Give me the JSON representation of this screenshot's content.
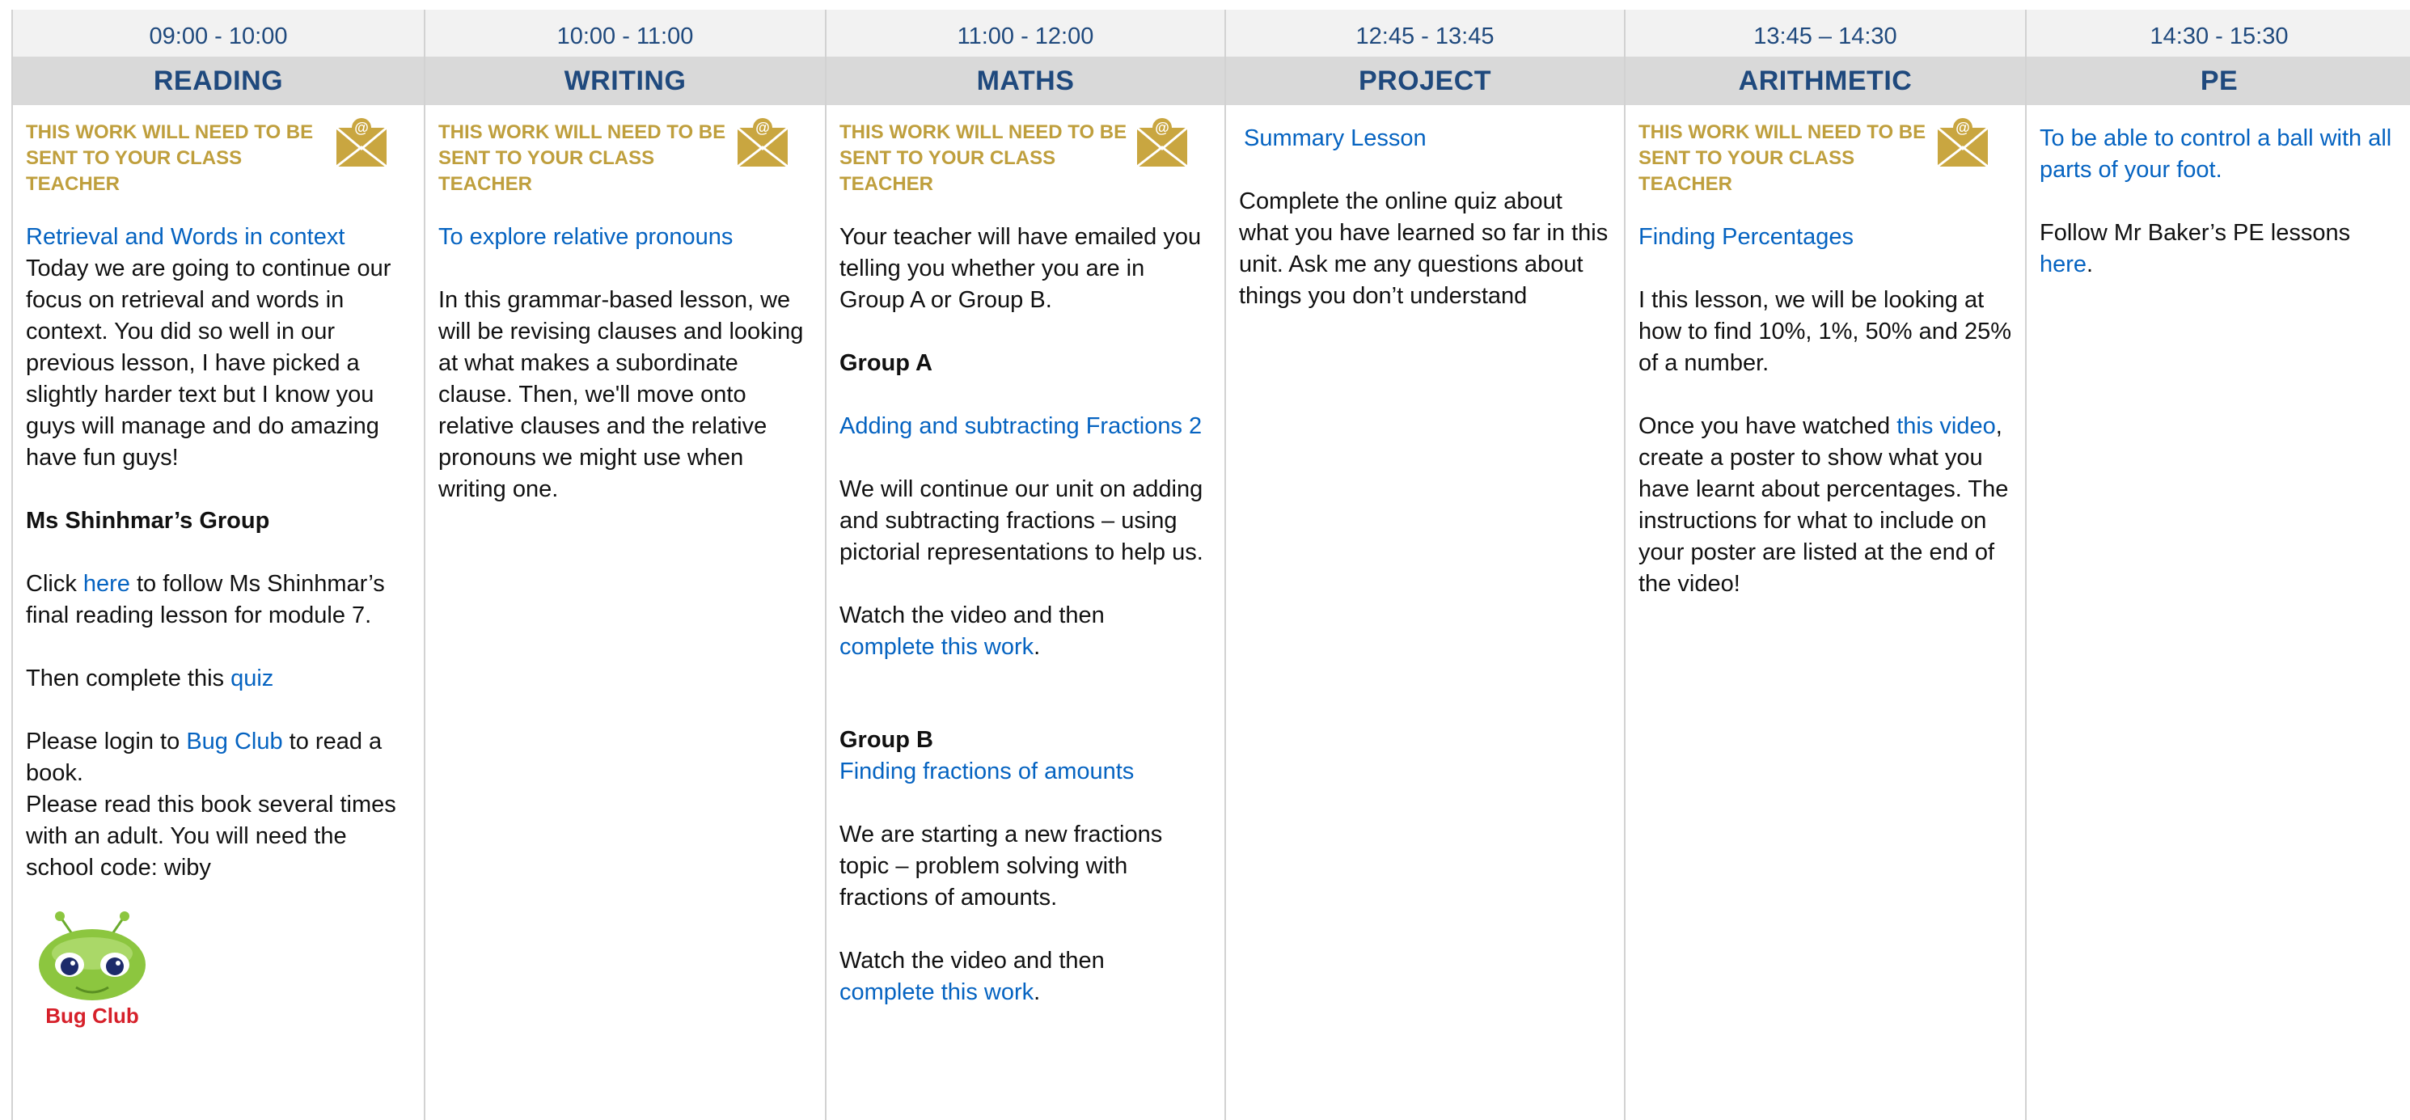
{
  "notice": "THIS WORK WILL NEED TO BE SENT TO YOUR CLASS TEACHER",
  "columns": {
    "reading": {
      "time": "09:00 - 10:00",
      "subject": "READING",
      "lesson_title": "Retrieval and Words in context",
      "intro": "Today we are going to continue our focus on retrieval and words in context. You did so well in our previous lesson, I have picked a slightly harder text but I know you guys will manage and do amazing have fun guys!",
      "group_heading": "Ms Shinhmar’s Group",
      "click_pre": "Click ",
      "click_link": "here",
      "click_post": " to follow Ms Shinhmar’s final reading lesson for module 7.",
      "quiz_pre": "Then complete this ",
      "quiz_link": "quiz",
      "bug_pre": "Please login to ",
      "bug_link": "Bug Club",
      "bug_post": " to read a book.",
      "read_instr": "Please read this book several times with an adult. You will need the school code: wiby",
      "logo_text": "Bug Club"
    },
    "writing": {
      "time": "10:00 - 11:00",
      "subject": "WRITING",
      "lesson_title": "To explore relative pronouns",
      "body": "In this grammar-based lesson, we will be revising clauses and looking at what makes a subordinate clause. Then, we'll move onto relative clauses and the relative pronouns we might use when writing one."
    },
    "maths": {
      "time": "11:00 - 12:00",
      "subject": "MATHS",
      "intro": "Your teacher will have emailed you telling you whether you are in Group A or Group B.",
      "group_a": "Group A",
      "a_title": "Adding and subtracting Fractions 2",
      "a_body": "We will continue our unit on adding and subtracting fractions – using pictorial representations to help us.",
      "a_watch": "Watch the video and then ",
      "a_link": "complete this work",
      "group_b": "Group B",
      "b_title": "Finding fractions of amounts",
      "b_body": "We are starting a new fractions topic – problem solving with fractions of amounts.",
      "b_watch": "Watch the video and then ",
      "b_link": "complete this work",
      "period": "."
    },
    "project": {
      "time": "12:45 - 13:45",
      "subject": "PROJECT",
      "lesson_title": "Summary Lesson",
      "body": "Complete the online quiz about what you have learned so far in this unit. Ask me any questions about things you don’t understand"
    },
    "arithmetic": {
      "time": "13:45 – 14:30",
      "subject": "ARITHMETIC",
      "lesson_title": "Finding Percentages",
      "body": "I this lesson, we will be looking at how to find 10%, 1%, 50% and 25% of a number.",
      "watch_pre": "Once you have watched ",
      "watch_link": "this video",
      "watch_post": ", create a poster to show what you have learnt about percentages. The instructions for what to include on your poster are listed at the end of the video!"
    },
    "pe": {
      "time": "14:30 - 15:30",
      "subject": "PE",
      "lesson_title": "To be able to control a ball with all parts of your foot.",
      "follow_pre": "Follow Mr Baker’s PE lessons ",
      "follow_link": "here",
      "follow_post": "."
    }
  }
}
